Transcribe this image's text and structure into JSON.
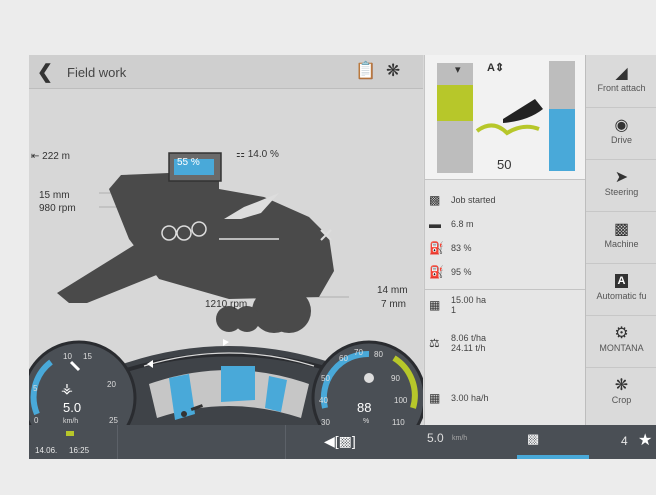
{
  "header": {
    "title": "Field work",
    "back_icon": "chevron-left-icon",
    "job_icon": "clipboard-icon",
    "crop_icon": "wheat-icon"
  },
  "machine": {
    "distance": "222 m",
    "slope": "14.0 %",
    "grain_tank": "55 %",
    "left_clearance": "15 mm",
    "left_rpm": "980 rpm",
    "bottom_rpm": "1210 rpm",
    "right_clearance_1": "14 mm",
    "right_clearance_2": "7 mm"
  },
  "gauges": {
    "speed": {
      "value": "5.0",
      "unit": "km/h",
      "ticks": [
        "0",
        "5",
        "10",
        "15",
        "20",
        "25"
      ]
    },
    "load": {
      "value": "88",
      "unit": "%",
      "ticks": [
        "30",
        "40",
        "50",
        "60",
        "70",
        "80",
        "90",
        "100",
        "110"
      ]
    }
  },
  "header_height": {
    "value": "50"
  },
  "info": {
    "job": "Job started",
    "width": "6.8 m",
    "fuel": "83 %",
    "adblue": "95 %",
    "area": "15.00 ha",
    "area_count": "1",
    "yield_per_ha": "8.06 t/ha",
    "yield_per_h": "24.11 t/h",
    "rate": "3.00 ha/h"
  },
  "nav": [
    {
      "label": "Front attach",
      "icon": "front-attachment-icon"
    },
    {
      "label": "Drive",
      "icon": "drive-icon"
    },
    {
      "label": "Steering",
      "icon": "steering-icon"
    },
    {
      "label": "Machine",
      "icon": "machine-icon"
    },
    {
      "label": "Automatic fu",
      "icon": "automatic-function-icon"
    },
    {
      "label": "MONTANA",
      "icon": "montana-icon"
    },
    {
      "label": "Crop",
      "icon": "wheat-icon"
    }
  ],
  "status": {
    "date": "14.06.",
    "time": "16:25",
    "speed": "5.0",
    "speed_unit": "km/h",
    "count": "4"
  },
  "colors": {
    "accent_blue": "#49a9d9",
    "lime": "#b7c72a",
    "status_bg": "#4a4f55"
  }
}
